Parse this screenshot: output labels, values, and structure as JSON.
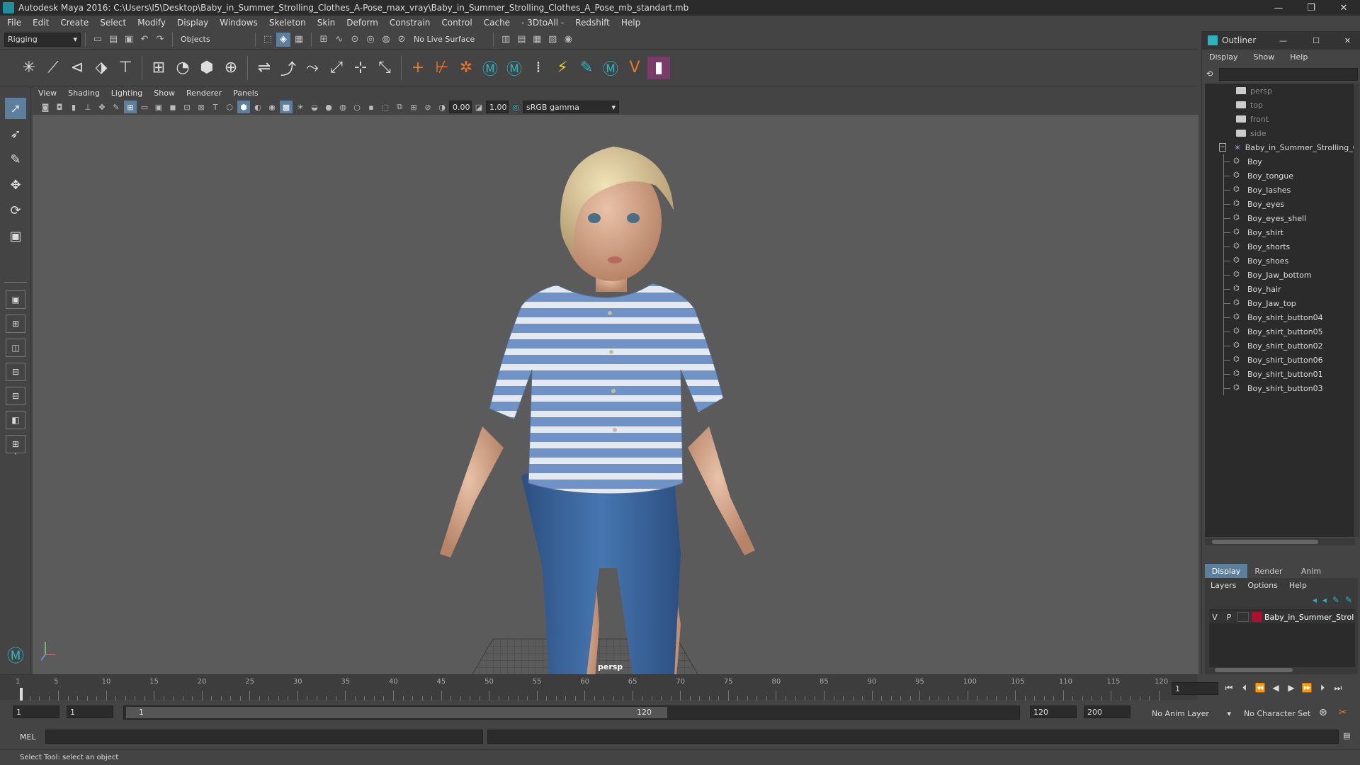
{
  "window": {
    "title": "Autodesk Maya 2016: C:\\Users\\I5\\Desktop\\Baby_in_Summer_Strolling_Clothes_A-Pose_max_vray\\Baby_in_Summer_Strolling_Clothes_A_Pose_mb_standart.mb",
    "minimize": "—",
    "restore": "❐",
    "close": "✕"
  },
  "menu": [
    "File",
    "Edit",
    "Create",
    "Select",
    "Modify",
    "Display",
    "Windows",
    "Skeleton",
    "Skin",
    "Deform",
    "Constrain",
    "Control",
    "Cache",
    "- 3DtoAll -",
    "Redshift",
    "Help"
  ],
  "status": {
    "mode": "Rigging",
    "objects": "Objects",
    "live_surface": "No Live Surface"
  },
  "viewport": {
    "menu": [
      "View",
      "Shading",
      "Lighting",
      "Show",
      "Renderer",
      "Panels"
    ],
    "exposure": "0.00",
    "gamma": "1.00",
    "color_space": "sRGB gamma",
    "camera_label": "persp"
  },
  "outliner": {
    "title": "Outliner",
    "menu": [
      "Display",
      "Show",
      "Help"
    ],
    "cameras": [
      "persp",
      "top",
      "front",
      "side"
    ],
    "group": "Baby_in_Summer_Strolling_C",
    "children": [
      "Boy",
      "Boy_tongue",
      "Boy_lashes",
      "Boy_eyes",
      "Boy_eyes_shell",
      "Boy_shirt",
      "Boy_shorts",
      "Boy_shoes",
      "Boy_Jaw_bottom",
      "Boy_hair",
      "Boy_Jaw_top",
      "Boy_shirt_button04",
      "Boy_shirt_button05",
      "Boy_shirt_button02",
      "Boy_shirt_button06",
      "Boy_shirt_button01",
      "Boy_shirt_button03"
    ]
  },
  "layer_editor": {
    "tabs": [
      "Display",
      "Render",
      "Anim"
    ],
    "menu": [
      "Layers",
      "Options",
      "Help"
    ],
    "layer": {
      "v": "V",
      "p": "P",
      "name": "Baby_in_Summer_Strol",
      "color": "#b01030"
    }
  },
  "timeline": {
    "ticks": [
      "1",
      "5",
      "10",
      "15",
      "20",
      "25",
      "30",
      "35",
      "40",
      "45",
      "50",
      "55",
      "60",
      "65",
      "70",
      "75",
      "80",
      "85",
      "90",
      "95",
      "100",
      "105",
      "110",
      "115",
      "120"
    ],
    "current_frame": "1"
  },
  "range": {
    "start": "1",
    "playback_start": "1",
    "slider_start": "1",
    "slider_end": "120",
    "playback_end": "120",
    "end": "200",
    "anim_layer": "No Anim Layer",
    "char_set": "No Character Set"
  },
  "cmd": {
    "lang": "MEL"
  },
  "help": "Select Tool: select an object"
}
